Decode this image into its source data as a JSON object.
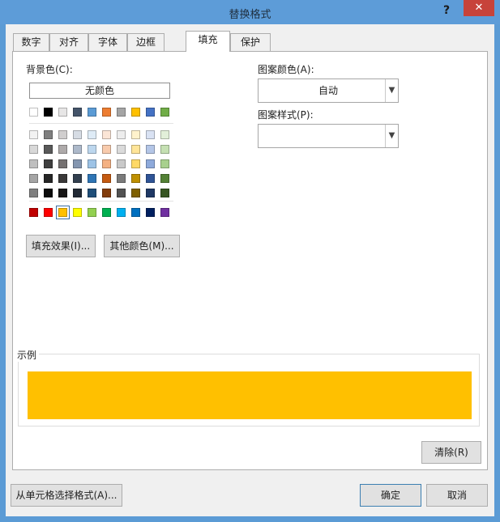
{
  "window": {
    "title": "替换格式",
    "help": "?",
    "close": "✕"
  },
  "tabs": [
    {
      "label": "数字"
    },
    {
      "label": "对齐"
    },
    {
      "label": "字体"
    },
    {
      "label": "边框"
    },
    {
      "label": "填充",
      "active": true
    },
    {
      "label": "保护"
    }
  ],
  "fill": {
    "background_label": "背景色(C):",
    "no_color_label": "无颜色",
    "theme_colors_top": [
      "#ffffff",
      "#000000",
      "#e7e6e6",
      "#44546a",
      "#5b9bd5",
      "#ed7d31",
      "#a5a5a5",
      "#ffc000",
      "#4472c4",
      "#70ad47"
    ],
    "theme_shades": [
      [
        "#f2f2f2",
        "#7f7f7f",
        "#d0cece",
        "#d6dce4",
        "#deebf6",
        "#fbe5d6",
        "#ededed",
        "#fff2cc",
        "#d9e2f3",
        "#e2efd9"
      ],
      [
        "#d8d8d8",
        "#595959",
        "#aeaaaa",
        "#adb9ca",
        "#bdd7ee",
        "#f8cbad",
        "#dbdbdb",
        "#ffe599",
        "#b4c6e7",
        "#c5e0b3"
      ],
      [
        "#bfbfbf",
        "#3f3f3f",
        "#757171",
        "#8496b0",
        "#9dc3e6",
        "#f4b183",
        "#c9c9c9",
        "#ffd966",
        "#8eaadb",
        "#a8d08d"
      ],
      [
        "#a5a5a5",
        "#262626",
        "#3a3838",
        "#323f4f",
        "#2e75b5",
        "#c55a11",
        "#7b7b7b",
        "#bf9000",
        "#2f5496",
        "#538135"
      ],
      [
        "#7f7f7f",
        "#0c0c0c",
        "#171616",
        "#222a35",
        "#1f4e79",
        "#833c0b",
        "#525252",
        "#7f6000",
        "#1f3864",
        "#375623"
      ]
    ],
    "standard_colors": [
      "#c00000",
      "#ff0000",
      "#ffc000",
      "#ffff00",
      "#92d050",
      "#00b050",
      "#00b0f0",
      "#0070c0",
      "#002060",
      "#7030a0"
    ],
    "selected_standard_index": 2,
    "fill_effects_label": "填充效果(I)...",
    "more_colors_label": "其他颜色(M)...",
    "pattern_color_label": "图案颜色(A):",
    "pattern_color_value": "自动",
    "pattern_style_label": "图案样式(P):",
    "pattern_style_value": "",
    "sample_label": "示例",
    "sample_color": "#ffc000",
    "clear_label": "清除(R)"
  },
  "footer": {
    "pick_from_cell_label": "从单元格选择格式(A)...",
    "ok_label": "确定",
    "cancel_label": "取消"
  }
}
